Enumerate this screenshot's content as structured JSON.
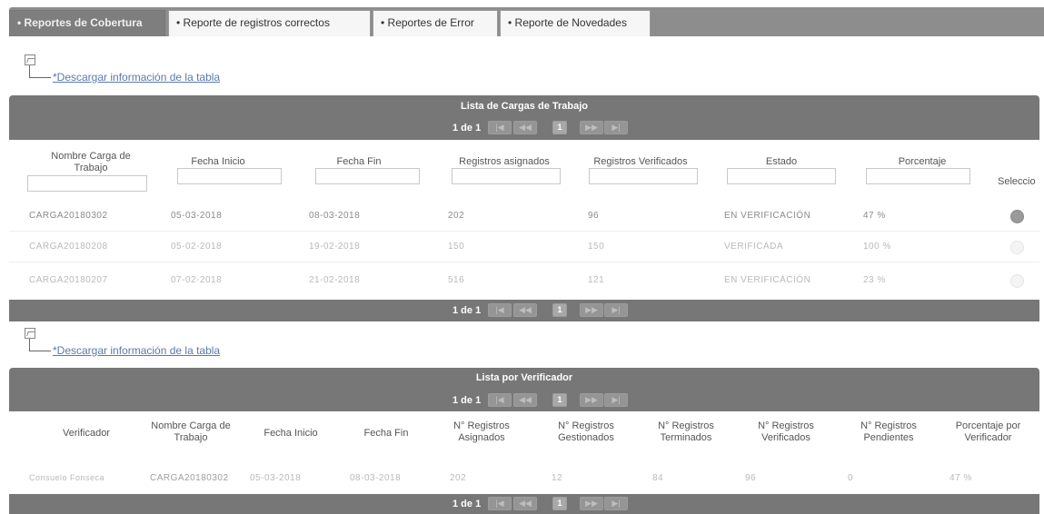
{
  "tabs": [
    {
      "label": "• Reportes de Cobertura",
      "active": true
    },
    {
      "label": "• Reporte de registros correctos",
      "active": false
    },
    {
      "label": "• Reportes de Error",
      "active": false
    },
    {
      "label": "• Reporte de Novedades",
      "active": false
    }
  ],
  "download_label": "*Descargar información de la tabla",
  "pager": {
    "info": "1 de 1",
    "first": "|◀",
    "prev": "◀◀",
    "page": "1",
    "next": "▶▶",
    "last": "▶|"
  },
  "table1": {
    "title": "Lista de Cargas de Trabajo",
    "headers": [
      "Nombre Carga de Trabajo",
      "Fecha Inicio",
      "Fecha Fin",
      "Registros asignados",
      "Registros Verificados",
      "Estado",
      "Porcentaje",
      "Seleccio"
    ],
    "rows": [
      [
        "CARGA20180302",
        "05-03-2018",
        "08-03-2018",
        "202",
        "96",
        "EN VERIFICACIÓN",
        "47 %"
      ],
      [
        "CARGA20180208",
        "05-02-2018",
        "19-02-2018",
        "150",
        "150",
        "VERIFICADA",
        "100 %"
      ],
      [
        "CARGA20180207",
        "07-02-2018",
        "21-02-2018",
        "516",
        "121",
        "EN VERIFICACIÓN",
        "23 %"
      ]
    ],
    "selected_row": 0
  },
  "table2": {
    "title": "Lista por Verificador",
    "headers": [
      "Verificador",
      "Nombre Carga de Trabajo",
      "Fecha Inicio",
      "Fecha Fin",
      "N° Registros Asignados",
      "N° Registros Gestionados",
      "N° Registros Terminados",
      "N° Registros Verificados",
      "N° Registros Pendientes",
      "Porcentaje por Verificador"
    ],
    "rows": [
      [
        "Consuelo Fonseca",
        "CARGA20180302",
        "05-03-2018",
        "08-03-2018",
        "202",
        "12",
        "84",
        "96",
        "0",
        "47 %"
      ]
    ]
  },
  "colors": {
    "band": "#777777",
    "tab_active": "#7e7e7e",
    "link": "#5a7aa8"
  }
}
